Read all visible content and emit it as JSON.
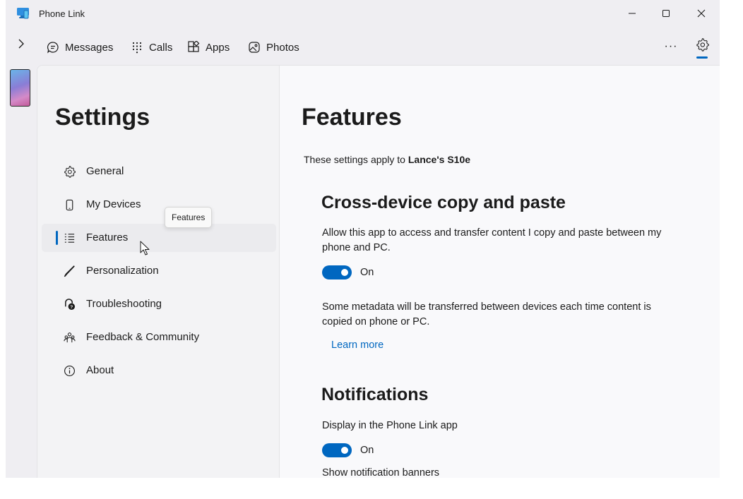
{
  "window": {
    "title": "Phone Link",
    "controls": {
      "minimize": "minimize-icon",
      "maximize": "maximize-icon",
      "close": "close-icon"
    }
  },
  "nav": {
    "expand_icon": "chevron-right-icon",
    "tabs": [
      {
        "label": "Messages",
        "icon": "chat-bubble-icon"
      },
      {
        "label": "Calls",
        "icon": "dialpad-icon"
      },
      {
        "label": "Apps",
        "icon": "apps-grid-icon"
      },
      {
        "label": "Photos",
        "icon": "photos-icon"
      }
    ],
    "more_label": "···",
    "settings_icon": "gear-icon"
  },
  "sidebar": {
    "title": "Settings",
    "items": [
      {
        "label": "General",
        "icon": "gear-icon"
      },
      {
        "label": "My Devices",
        "icon": "phone-icon"
      },
      {
        "label": "Features",
        "icon": "list-icon",
        "selected": true
      },
      {
        "label": "Personalization",
        "icon": "brush-icon"
      },
      {
        "label": "Troubleshooting",
        "icon": "troubleshoot-icon"
      },
      {
        "label": "Feedback & Community",
        "icon": "people-icon"
      },
      {
        "label": "About",
        "icon": "info-icon"
      }
    ],
    "tooltip": "Features"
  },
  "main": {
    "title": "Features",
    "applies_prefix": "These settings apply to ",
    "device_name": "Lance's S10e",
    "sections": {
      "copy_paste": {
        "heading": "Cross-device copy and paste",
        "description": "Allow this app to access and transfer content I copy and paste between my phone and PC.",
        "toggle_label": "On",
        "toggle_on": true,
        "note": "Some metadata will be transferred between devices each time content is copied on phone or PC.",
        "learn_more": "Learn more"
      },
      "notifications": {
        "heading": "Notifications",
        "description": "Display in the Phone Link app",
        "toggle_label": "On",
        "toggle_on": true,
        "banner_text": "Show notification banners"
      }
    }
  },
  "colors": {
    "accent": "#0067c0",
    "window_bg": "#efeef2",
    "content_bg": "#f9f9fb"
  }
}
